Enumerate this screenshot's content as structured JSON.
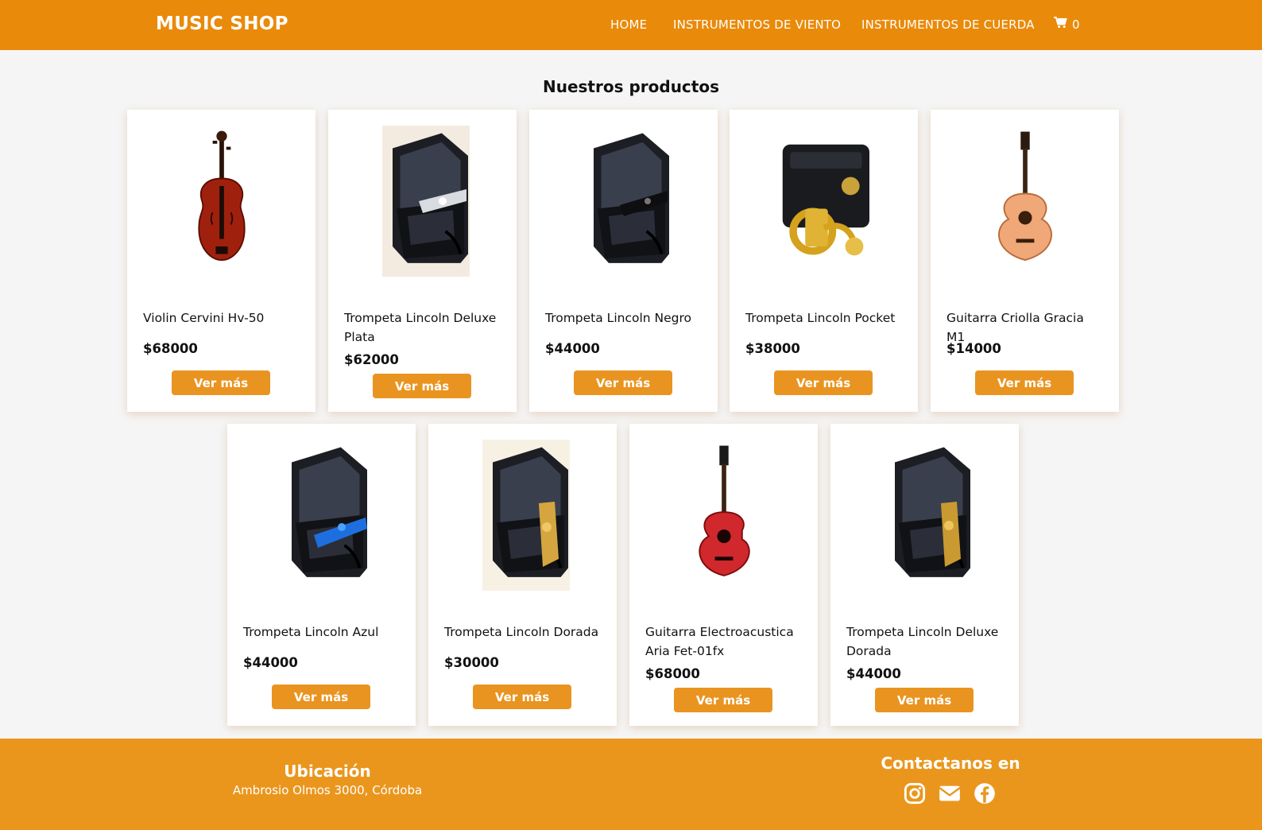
{
  "brand": "MUSIC SHOP",
  "nav": {
    "home": "HOME",
    "wind": "INSTRUMENTOS DE VIENTO",
    "string": "INSTRUMENTOS DE CUERDA",
    "cart_count": "0"
  },
  "section_title": "Nuestros productos",
  "button_label": "Ver más",
  "products": [
    {
      "name": "Violin Cervini Hv-50",
      "price": "$68000",
      "icon": "violin-icon"
    },
    {
      "name": "Trompeta Lincoln Deluxe Plata",
      "price": "$62000",
      "icon": "trumpet-case-icon"
    },
    {
      "name": "Trompeta Lincoln Negro",
      "price": "$44000",
      "icon": "trumpet-case-icon"
    },
    {
      "name": "Trompeta Lincoln Pocket",
      "price": "$38000",
      "icon": "pocket-trumpet-icon"
    },
    {
      "name": "Guitarra Criolla Gracia M1",
      "price": "$14000",
      "icon": "classical-guitar-icon"
    },
    {
      "name": "Trompeta Lincoln Azul",
      "price": "$44000",
      "icon": "trumpet-case-icon"
    },
    {
      "name": "Trompeta Lincoln Dorada",
      "price": "$30000",
      "icon": "trumpet-case-icon"
    },
    {
      "name": "Guitarra Electroacustica Aria Fet-01fx",
      "price": "$68000",
      "icon": "electroacoustic-guitar-icon"
    },
    {
      "name": "Trompeta Lincoln Deluxe Dorada",
      "price": "$44000",
      "icon": "trumpet-case-icon"
    }
  ],
  "footer": {
    "location_title": "Ubicación",
    "location_text": "Ambrosio Olmos 3000, Córdoba",
    "contact_title": "Contactanos en",
    "social_icons": [
      "instagram-icon",
      "envelope-icon",
      "facebook-icon"
    ]
  },
  "colors": {
    "navbar": "#e98a0a",
    "footer": "#ea961d",
    "button": "#e99420",
    "background": "#f5f5f5"
  }
}
